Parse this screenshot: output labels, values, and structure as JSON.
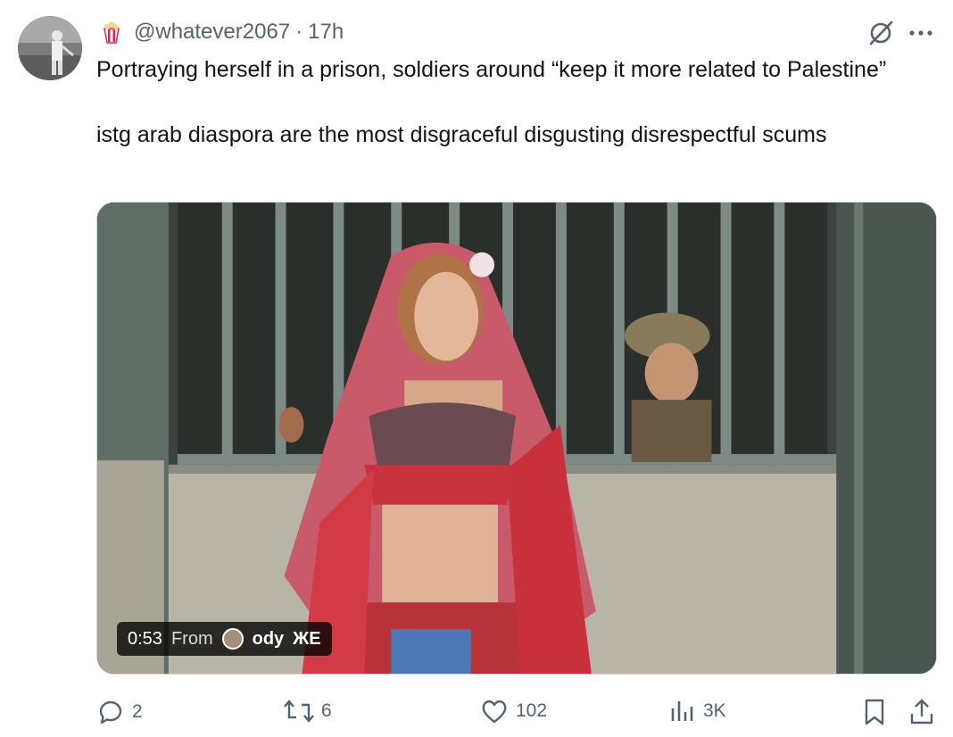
{
  "tweet": {
    "handle": "@whatever2067",
    "separator": "·",
    "time": "17h",
    "text_line1": "Portraying herself in a prison, soldiers around “keep it more related to Palestine”",
    "text_line2": "istg arab diaspora are the most disgraceful disgusting disrespectful scums"
  },
  "media": {
    "duration": "0:53",
    "from_label": "From",
    "source_name": "ody",
    "source_glyph": "ЖЕ"
  },
  "actions": {
    "replies": "2",
    "reposts": "6",
    "likes": "102",
    "views": "3K"
  },
  "icons": {
    "badge": "popcorn-icon",
    "grok": "grok-icon",
    "more": "more-icon",
    "reply": "reply-icon",
    "repost": "repost-icon",
    "like": "heart-icon",
    "views": "views-icon",
    "bookmark": "bookmark-icon",
    "share": "share-icon"
  },
  "colors": {
    "text": "#0f1419",
    "secondary": "#536471",
    "badge_red": "#e0245e"
  }
}
